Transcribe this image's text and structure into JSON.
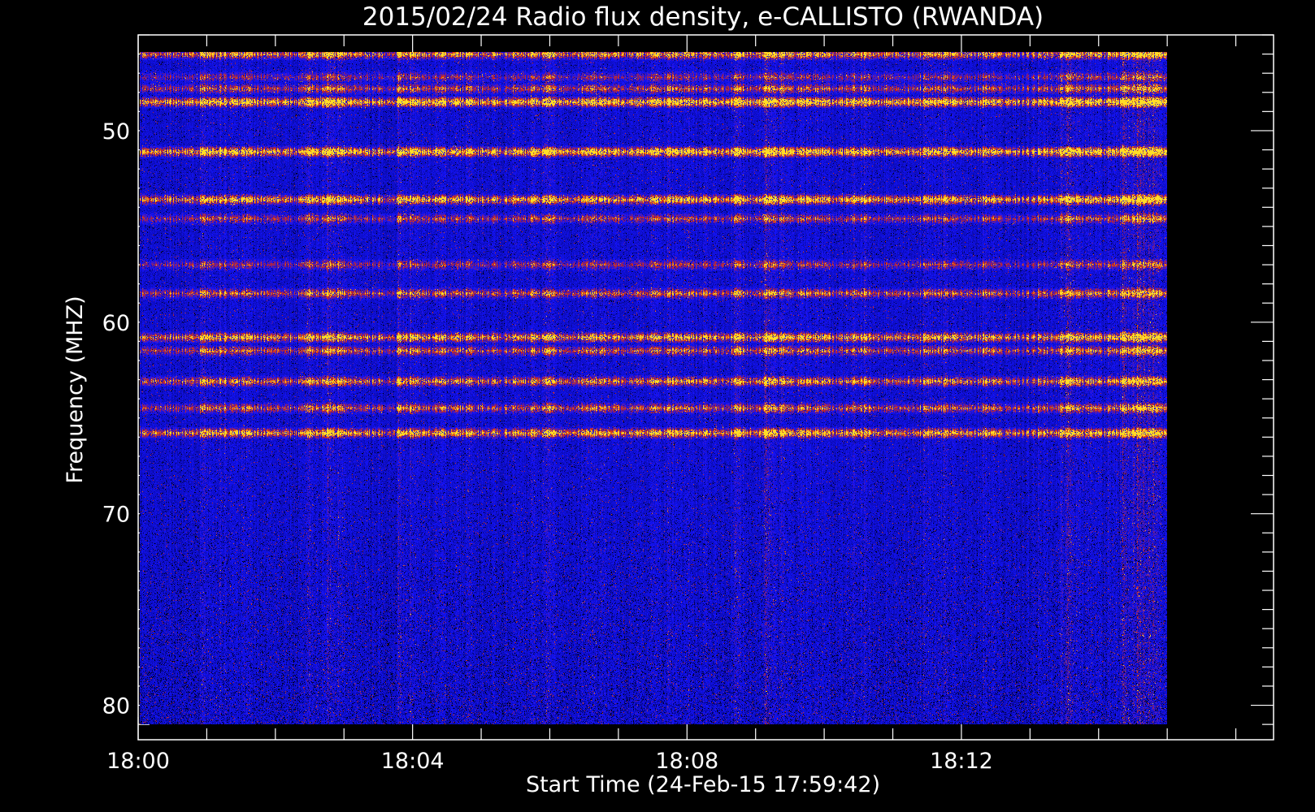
{
  "colors": {
    "background": "#000000",
    "frame": "#ffffff",
    "low": "#1414d2",
    "mid": "#c81e0a",
    "high": "#ffd21e"
  },
  "chart_data": {
    "type": "heatmap",
    "title": "2015/02/24  Radio flux density, e-CALLISTO (RWANDA)",
    "xlabel": "Start Time (24-Feb-15 17:59:42)",
    "ylabel": "Frequency (MHZ)",
    "x_ticks": [
      "18:00",
      "18:04",
      "18:08",
      "18:12"
    ],
    "x_tick_minutes": [
      0,
      4,
      8,
      12
    ],
    "x_range_minutes": [
      0,
      16.55
    ],
    "x_data_range_minutes": [
      0.02,
      15.0
    ],
    "y_ticks": [
      50,
      60,
      70,
      80
    ],
    "y_range": [
      45,
      81.8
    ],
    "y_data_range": [
      45.9,
      81.0
    ],
    "y_inverted": true,
    "colormap": "blue-red-yellow",
    "emission_bands_mhz": [
      {
        "freq": 46.0,
        "strength": 0.75
      },
      {
        "freq": 47.2,
        "strength": 0.4
      },
      {
        "freq": 47.8,
        "strength": 0.55
      },
      {
        "freq": 48.5,
        "strength": 0.95
      },
      {
        "freq": 51.1,
        "strength": 0.95
      },
      {
        "freq": 53.6,
        "strength": 0.85
      },
      {
        "freq": 54.6,
        "strength": 0.5
      },
      {
        "freq": 57.0,
        "strength": 0.45
      },
      {
        "freq": 58.5,
        "strength": 0.6
      },
      {
        "freq": 60.8,
        "strength": 0.8
      },
      {
        "freq": 61.5,
        "strength": 0.6
      },
      {
        "freq": 63.1,
        "strength": 0.7
      },
      {
        "freq": 64.5,
        "strength": 0.6
      },
      {
        "freq": 65.8,
        "strength": 0.8
      }
    ]
  }
}
